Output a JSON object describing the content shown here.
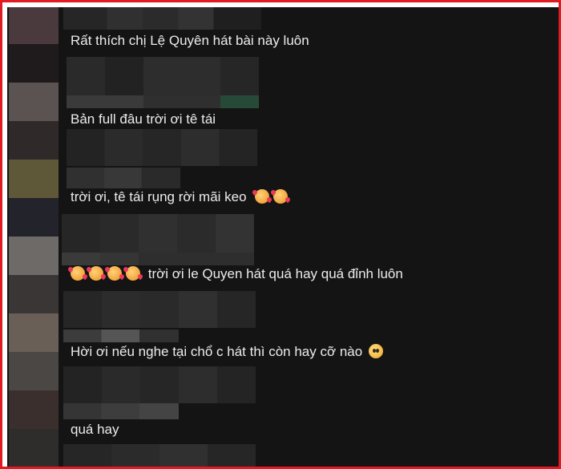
{
  "comments": [
    {
      "text": "Rất thích chị Lệ Quyên hát bài này luôn",
      "emoji_before": 0,
      "emoji_after": 0
    },
    {
      "text": "Bản full đâu trời ơi tê tái",
      "emoji_before": 0,
      "emoji_after": 0
    },
    {
      "text": "trời ơi, tê tái rụng rời mãi keo",
      "emoji_before": 0,
      "emoji_after": 2,
      "emoji_icon": "smiling-face-with-hearts-icon"
    },
    {
      "text": "trời ơi le Quyen hát quá hay quá đỉnh luôn",
      "emoji_before": 4,
      "emoji_after": 0,
      "emoji_icon": "smiling-face-with-hearts-icon"
    },
    {
      "text": "Hời ơi nếu nghe tại chổ c hát thì còn hay cỡ nào",
      "emoji_before": 0,
      "emoji_after": 1,
      "emoji_icon": "pleading-face-icon"
    },
    {
      "text": "quá hay",
      "emoji_before": 0,
      "emoji_after": 0
    }
  ],
  "colors": {
    "frame_border": "#e01b22",
    "panel_background": "#141414",
    "comment_text": "#ececec"
  }
}
